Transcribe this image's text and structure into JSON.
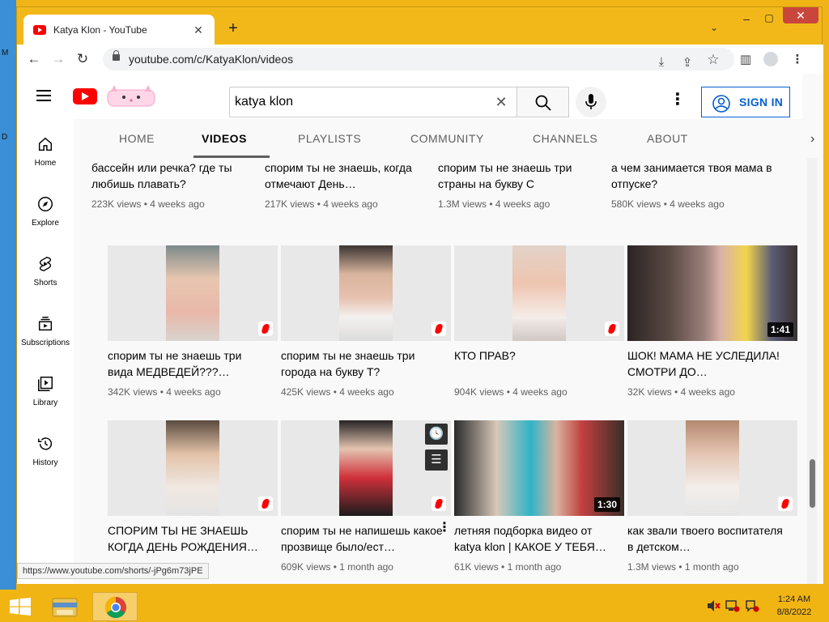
{
  "desktop": {
    "labels": [
      "M",
      "D"
    ]
  },
  "browser": {
    "tab_title": "Katya Klon - YouTube",
    "tab_close": "✕",
    "new_tab": "+",
    "tab_search": "⌄",
    "win_min": "–",
    "win_max": "▢",
    "win_close": "✕",
    "back": "←",
    "forward": "→",
    "reload": "↻",
    "url": "youtube.com/c/KatyaKlon/videos",
    "toolbar_icons": {
      "install": "⤓",
      "share": "⇪",
      "star": "☆",
      "sidepanel": "▥",
      "menu": "⋮"
    }
  },
  "youtube": {
    "search_value": "katya klon",
    "search_clear": "✕",
    "more": "⋮",
    "sign_in": "SIGN IN",
    "guide": [
      {
        "label": "Home",
        "icon": "home-icon"
      },
      {
        "label": "Explore",
        "icon": "compass-icon"
      },
      {
        "label": "Shorts",
        "icon": "shorts-icon"
      },
      {
        "label": "Subscriptions",
        "icon": "subscriptions-icon"
      },
      {
        "label": "Library",
        "icon": "library-icon"
      },
      {
        "label": "History",
        "icon": "history-icon"
      }
    ],
    "channel_tabs": [
      "HOME",
      "VIDEOS",
      "PLAYLISTS",
      "COMMUNITY",
      "CHANNELS",
      "ABOUT"
    ],
    "channel_next": "›",
    "rows": [
      [
        {
          "title": "бассейн или речка? где ты любишь плавать?",
          "views": "223K views",
          "age": "4 weeks ago"
        },
        {
          "title": "спорим ты не знаешь, когда отмечают День…",
          "views": "217K views",
          "age": "4 weeks ago"
        },
        {
          "title": "спорим ты не знаешь три страны на букву С",
          "views": "1.3M views",
          "age": "4 weeks ago"
        },
        {
          "title": "а чем занимается твоя мама в отпуске?",
          "views": "580K views",
          "age": "4 weeks ago"
        }
      ],
      [
        {
          "title": "спорим ты не знаешь три вида МЕДВЕДЕЙ???…",
          "views": "342K views",
          "age": "4 weeks ago",
          "short": true
        },
        {
          "title": "спорим ты не знаешь три города на букву Т?",
          "views": "425K views",
          "age": "4 weeks ago",
          "short": true
        },
        {
          "title": "КТО ПРАВ?",
          "views": "904K views",
          "age": "4 weeks ago",
          "short": true
        },
        {
          "title": "ШОК! МАМА НЕ УСЛЕДИЛА! СМОТРИ ДО…",
          "views": "32K views",
          "age": "4 weeks ago",
          "duration": "1:41"
        }
      ],
      [
        {
          "title": "СПОРИМ ТЫ НЕ ЗНАЕШЬ КОГДА ДЕНЬ РОЖДЕНИЯ…",
          "views": "",
          "age": "",
          "short": true
        },
        {
          "title": "спорим ты не напишешь какое прозвище было/ест…",
          "views": "609K views",
          "age": "1 month ago",
          "short": true
        },
        {
          "title": "летняя подборка видео от katya klon | КАКОЕ У ТЕБЯ…",
          "views": "61K views",
          "age": "1 month ago",
          "duration": "1:30"
        },
        {
          "title": "как звали твоего воспитателя в детском…",
          "views": "1.3M views",
          "age": "1 month ago",
          "short": true
        }
      ]
    ],
    "hover_icons": {
      "watch_later": "🕓",
      "queue": "☰"
    },
    "card_menu": "⋮",
    "status_url": "https://www.youtube.com/shorts/-jPg6m73jPE"
  },
  "taskbar": {
    "clock_time": "1:24 AM",
    "clock_date": "8/8/2022"
  }
}
